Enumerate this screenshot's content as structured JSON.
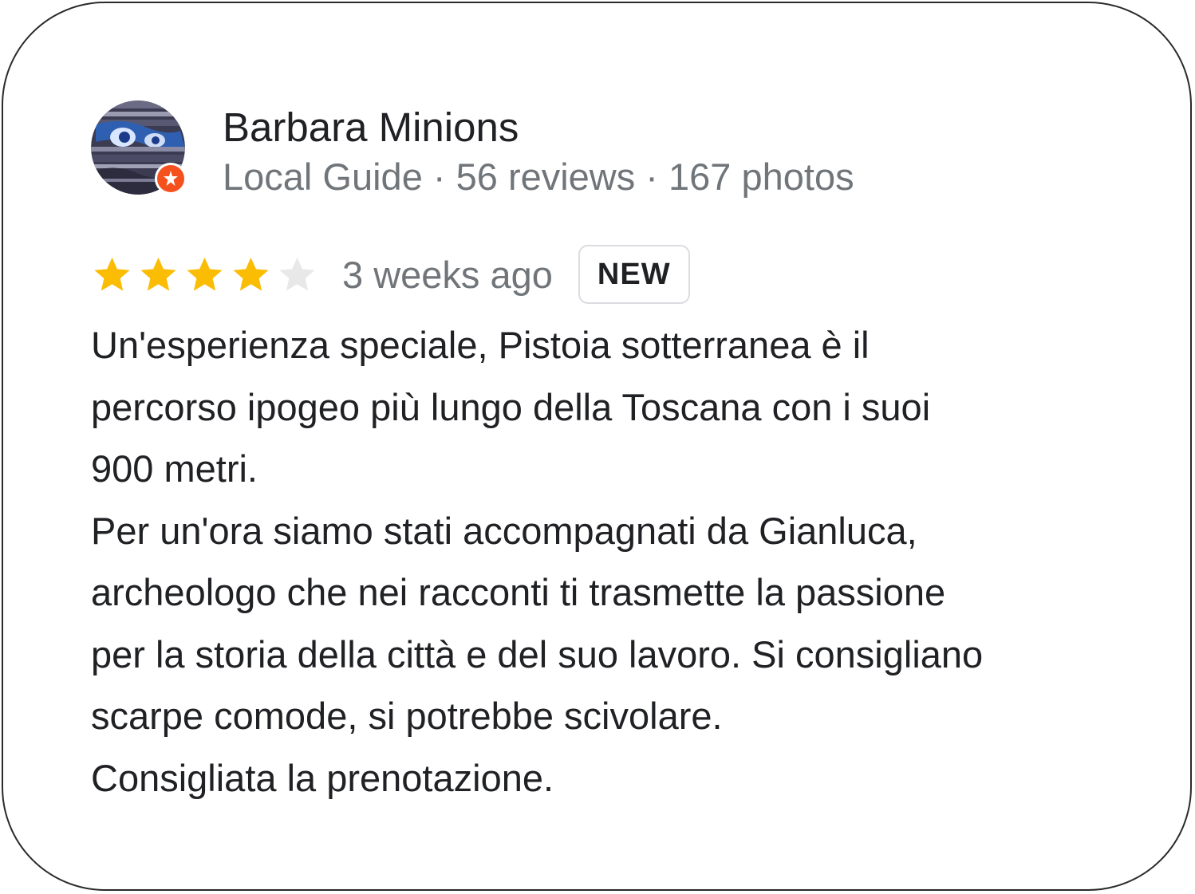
{
  "review": {
    "author": {
      "name": "Barbara Minions",
      "meta": "Local Guide · 56 reviews · 167 photos",
      "avatar_icon": "user-avatar-photo",
      "badge_icon": "local-guide-badge-icon"
    },
    "rating": {
      "value": 4,
      "max": 5,
      "filled_color": "#fbbc04",
      "empty_color": "#e8e8e8"
    },
    "time_ago": "3 weeks ago",
    "badge": "NEW",
    "text_lines": [
      "Un'esperienza speciale, Pistoia sotterranea è il",
      "percorso ipogeo più lungo della Toscana con i suoi",
      "900 metri.",
      "Per un'ora siamo stati accompagnati da Gianluca,",
      "archeologo che nei racconti ti trasmette la passione",
      "per la storia della città e del suo lavoro. Si consigliano",
      "scarpe comode, si potrebbe scivolare.",
      "Consigliata la prenotazione."
    ]
  },
  "colors": {
    "text_primary": "#202124",
    "text_secondary": "#70757a",
    "local_guide_orange": "#f4511e"
  }
}
